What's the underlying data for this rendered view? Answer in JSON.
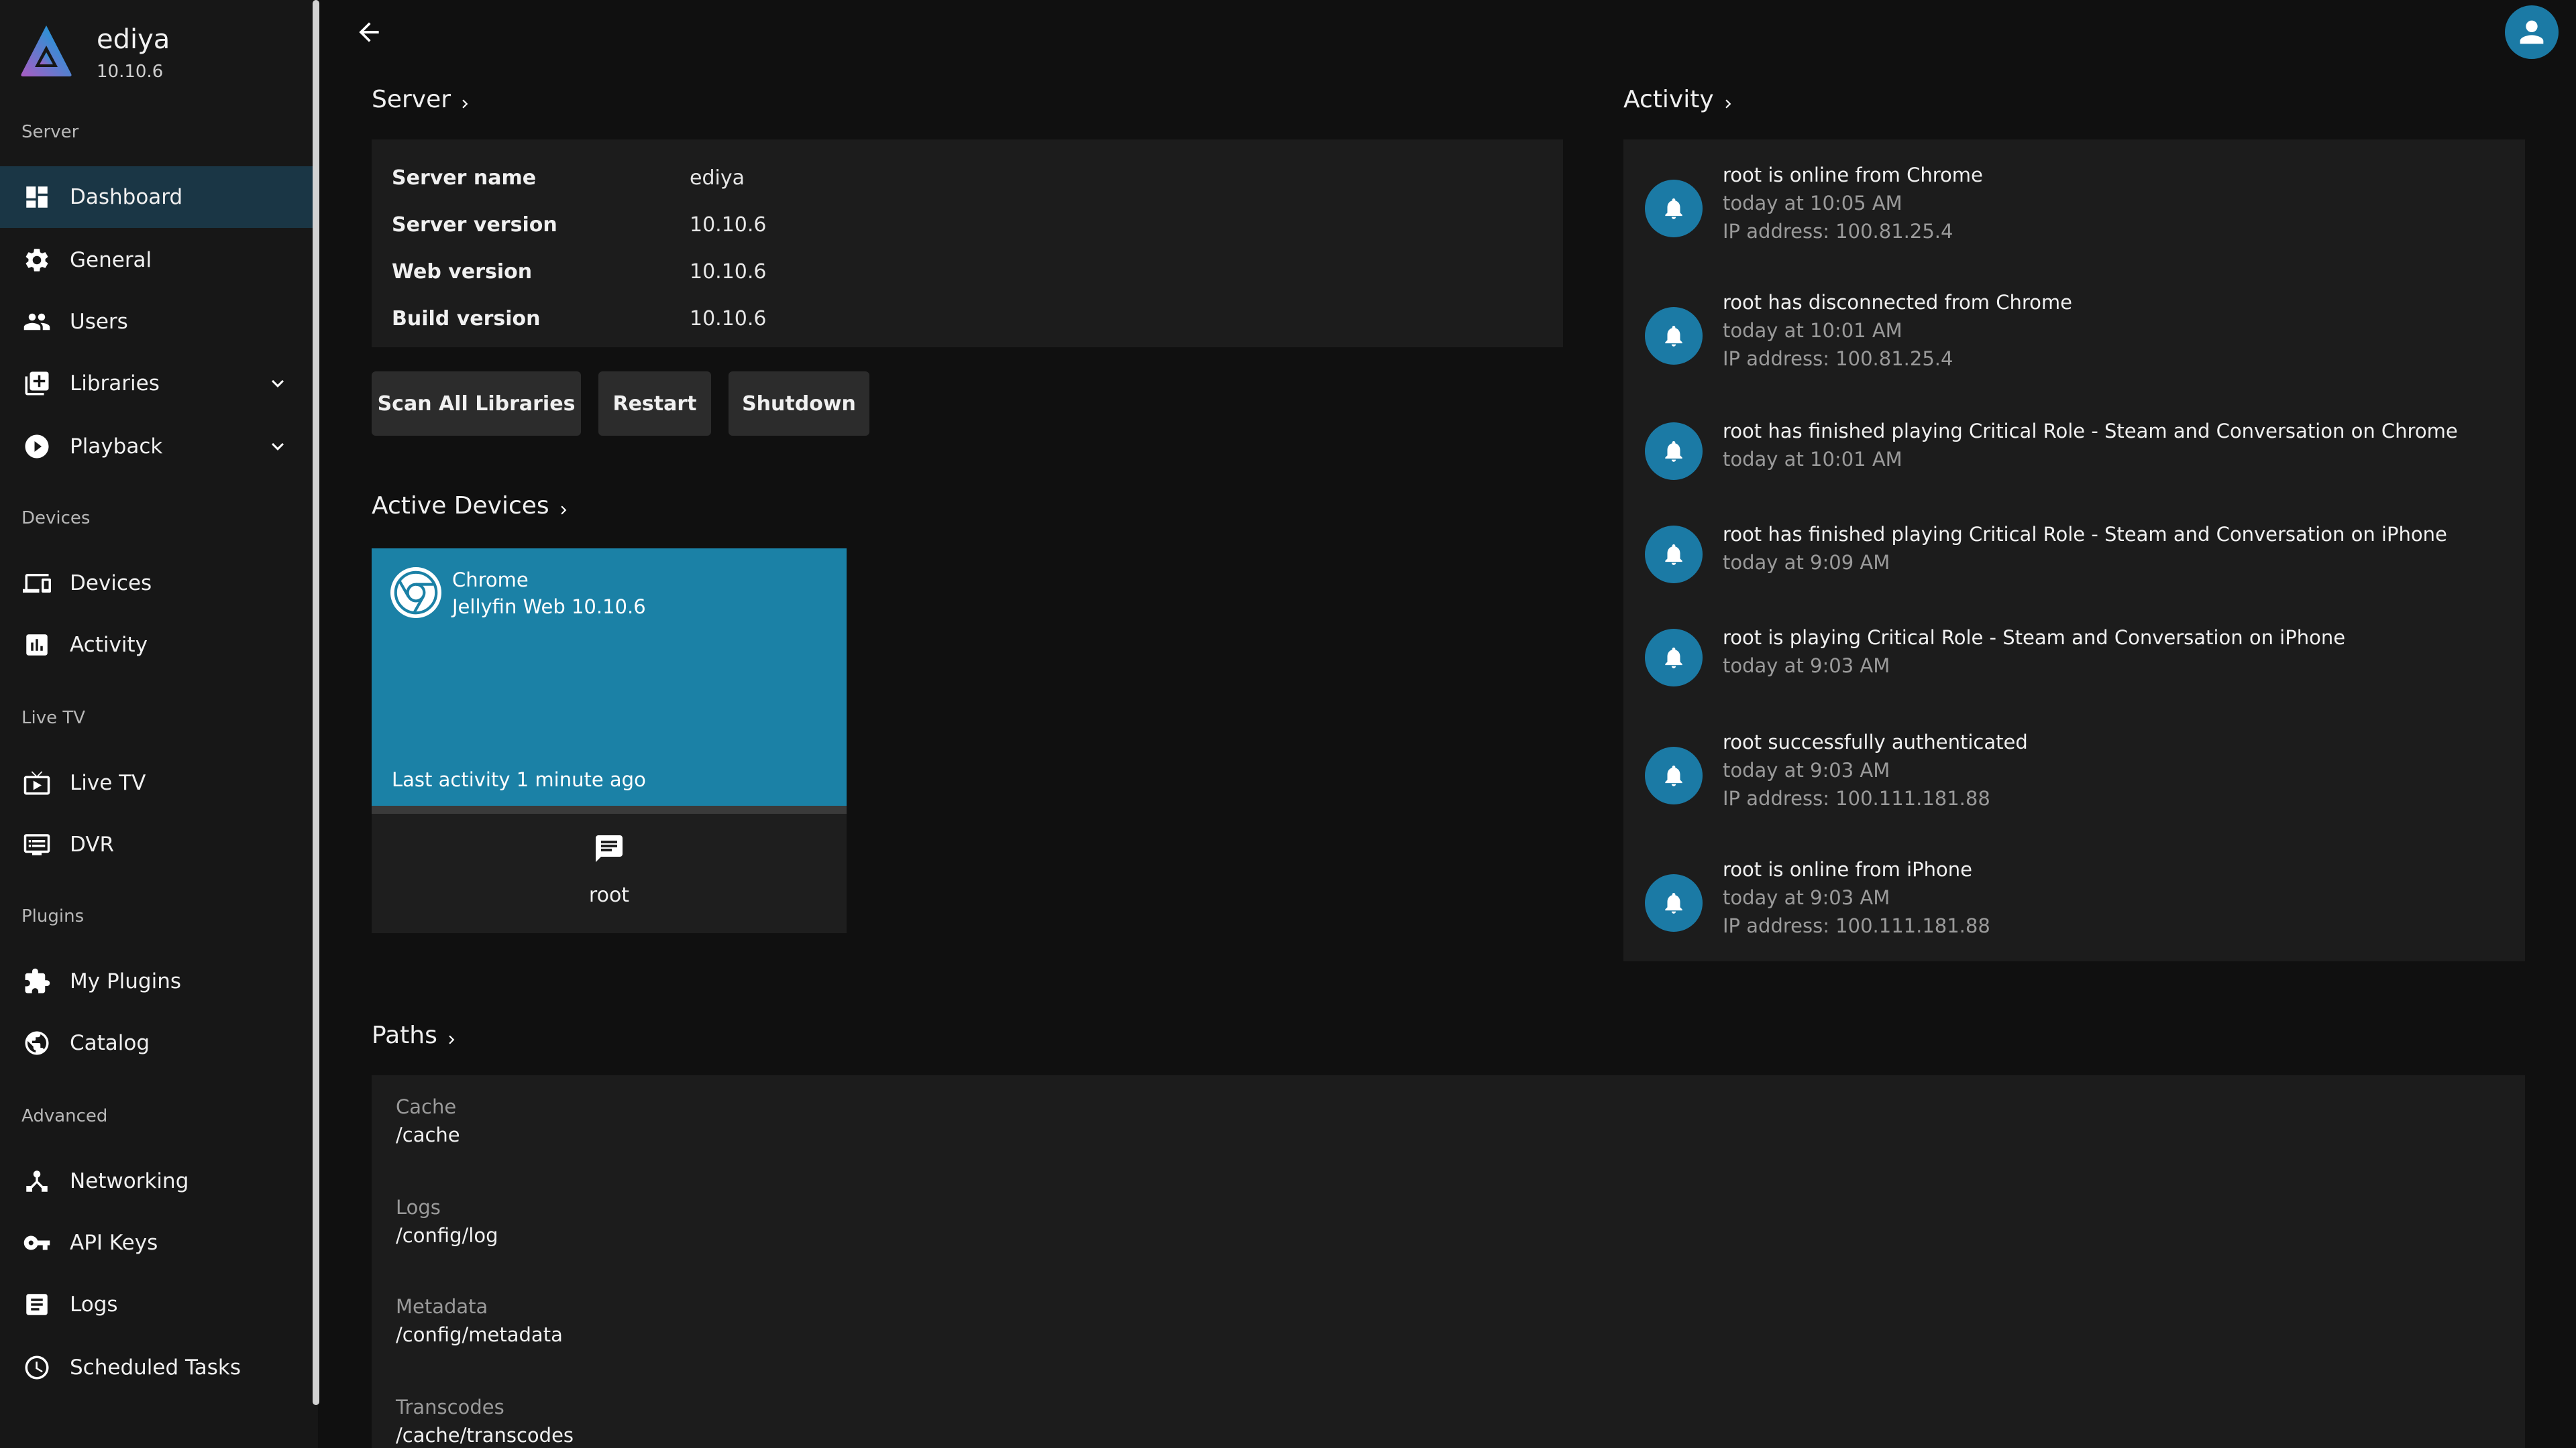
{
  "brand": {
    "name": "ediya",
    "version": "10.10.6"
  },
  "sidebar": {
    "sections": {
      "server": "Server",
      "devices": "Devices",
      "live_tv": "Live TV",
      "plugins": "Plugins",
      "advanced": "Advanced"
    },
    "items": {
      "dashboard": "Dashboard",
      "general": "General",
      "users": "Users",
      "libraries": "Libraries",
      "playback": "Playback",
      "devices": "Devices",
      "activity": "Activity",
      "live_tv": "Live TV",
      "dvr": "DVR",
      "my_plugins": "My Plugins",
      "catalog": "Catalog",
      "networking": "Networking",
      "api_keys": "API Keys",
      "logs": "Logs",
      "scheduled_tasks": "Scheduled Tasks"
    },
    "active_item": "Dashboard"
  },
  "server": {
    "heading": "Server",
    "rows": [
      {
        "key": "Server name",
        "value": "ediya"
      },
      {
        "key": "Server version",
        "value": "10.10.6"
      },
      {
        "key": "Web version",
        "value": "10.10.6"
      },
      {
        "key": "Build version",
        "value": "10.10.6"
      }
    ],
    "buttons": {
      "scan": "Scan All Libraries",
      "restart": "Restart",
      "shutdown": "Shutdown"
    }
  },
  "active_devices": {
    "heading": "Active Devices",
    "device": {
      "name": "Chrome",
      "client": "Jellyfin Web 10.10.6",
      "last_activity": "Last activity 1 minute ago",
      "user": "root"
    }
  },
  "activity": {
    "heading": "Activity",
    "items": [
      {
        "title": "root is online from Chrome",
        "time": "today at 10:05 AM",
        "detail": "IP address: 100.81.25.4"
      },
      {
        "title": "root has disconnected from Chrome",
        "time": "today at 10:01 AM",
        "detail": "IP address: 100.81.25.4"
      },
      {
        "title": "root has finished playing Critical Role - Steam and Conversation on Chrome",
        "time": "today at 10:01 AM",
        "detail": ""
      },
      {
        "title": "root has finished playing Critical Role - Steam and Conversation on iPhone",
        "time": "today at 9:09 AM",
        "detail": ""
      },
      {
        "title": "root is playing Critical Role - Steam and Conversation on iPhone",
        "time": "today at 9:03 AM",
        "detail": ""
      },
      {
        "title": "root successfully authenticated",
        "time": "today at 9:03 AM",
        "detail": "IP address: 100.111.181.88"
      },
      {
        "title": "root is online from iPhone",
        "time": "today at 9:03 AM",
        "detail": "IP address: 100.111.181.88"
      }
    ]
  },
  "paths": {
    "heading": "Paths",
    "items": [
      {
        "label": "Cache",
        "value": "/cache"
      },
      {
        "label": "Logs",
        "value": "/config/log"
      },
      {
        "label": "Metadata",
        "value": "/config/metadata"
      },
      {
        "label": "Transcodes",
        "value": "/cache/transcodes"
      }
    ]
  },
  "icons": {
    "brand": "jellyfin-logo-icon",
    "back": "arrow-back-icon",
    "avatar": "person-icon",
    "activity": "bell-icon",
    "device_app": "chrome-icon",
    "message": "message-icon"
  },
  "colors": {
    "accent": "#1b7aa5",
    "device_card": "#1b81a6",
    "active_nav": "#1a3645",
    "background": "#101010",
    "sidebar": "#171717",
    "card": "#1c1c1c"
  }
}
